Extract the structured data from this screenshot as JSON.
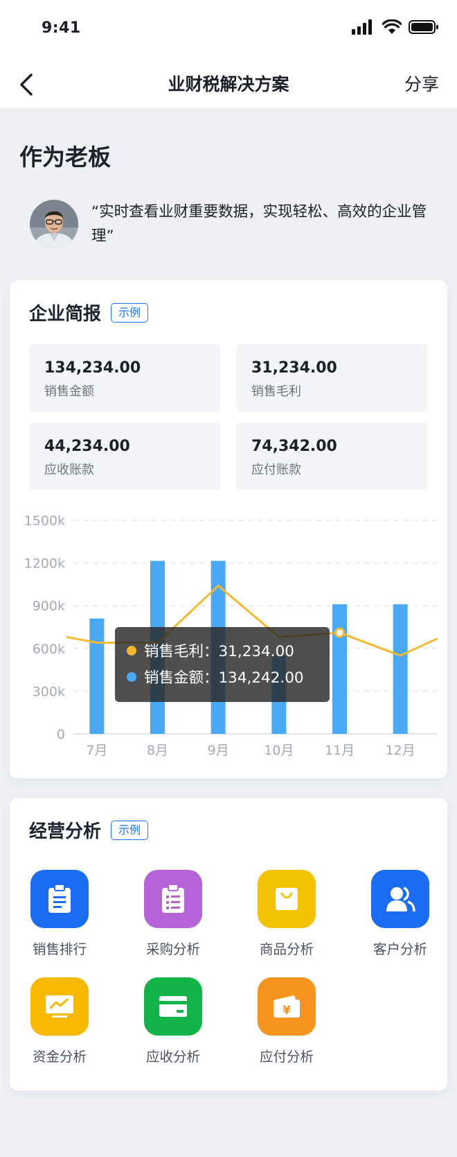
{
  "status": {
    "time": "9:41"
  },
  "nav": {
    "title": "业财税解决方案",
    "share": "分享"
  },
  "section": {
    "title": "作为老板"
  },
  "boss": {
    "quote": "“实时查看业财重要数据，实现轻松、高效的企业管理”"
  },
  "brief": {
    "title": "企业简报",
    "tag": "示例",
    "stats": [
      {
        "value": "134,234.00",
        "label": "销售金额"
      },
      {
        "value": "31,234.00",
        "label": "销售毛利"
      },
      {
        "value": "44,234.00",
        "label": "应收账款"
      },
      {
        "value": "74,342.00",
        "label": "应付账款"
      }
    ]
  },
  "chart_data": {
    "type": "bar",
    "categories": [
      "7月",
      "8月",
      "9月",
      "10月",
      "11月",
      "12月"
    ],
    "yticks": [
      "1500k",
      "1200k",
      "900k",
      "600k",
      "300k",
      "0"
    ],
    "ylim": [
      0,
      1500
    ],
    "series": [
      {
        "name": "销售金额",
        "type": "bar",
        "color": "#4aa9f5",
        "values": [
          810,
          1215,
          1215,
          550,
          910,
          910
        ]
      },
      {
        "name": "销售毛利",
        "type": "line",
        "color": "#f5b82e",
        "values": [
          640,
          640,
          1040,
          680,
          710,
          550
        ]
      }
    ],
    "grid": true,
    "tooltip": {
      "category": "11月",
      "lines": [
        {
          "color": "#f5b82e",
          "text": "销售毛利：31,234.00"
        },
        {
          "color": "#4aa9f5",
          "text": "销售金额：134,242.00"
        }
      ]
    }
  },
  "analysis": {
    "title": "经营分析",
    "tag": "示例",
    "items": [
      {
        "label": "销售排行",
        "icon": "clipboard-icon",
        "color": "#1a6cf5"
      },
      {
        "label": "采购分析",
        "icon": "checklist-icon",
        "color": "#b464d7"
      },
      {
        "label": "商品分析",
        "icon": "shopping-bag-icon",
        "color": "#f3c200"
      },
      {
        "label": "客户分析",
        "icon": "users-icon",
        "color": "#1a6cf5"
      },
      {
        "label": "资金分析",
        "icon": "trend-chart-icon",
        "color": "#f6b900"
      },
      {
        "label": "应收分析",
        "icon": "card-icon",
        "color": "#12b44a"
      },
      {
        "label": "应付分析",
        "icon": "yen-wallet-icon",
        "color": "#f7941e"
      }
    ]
  }
}
